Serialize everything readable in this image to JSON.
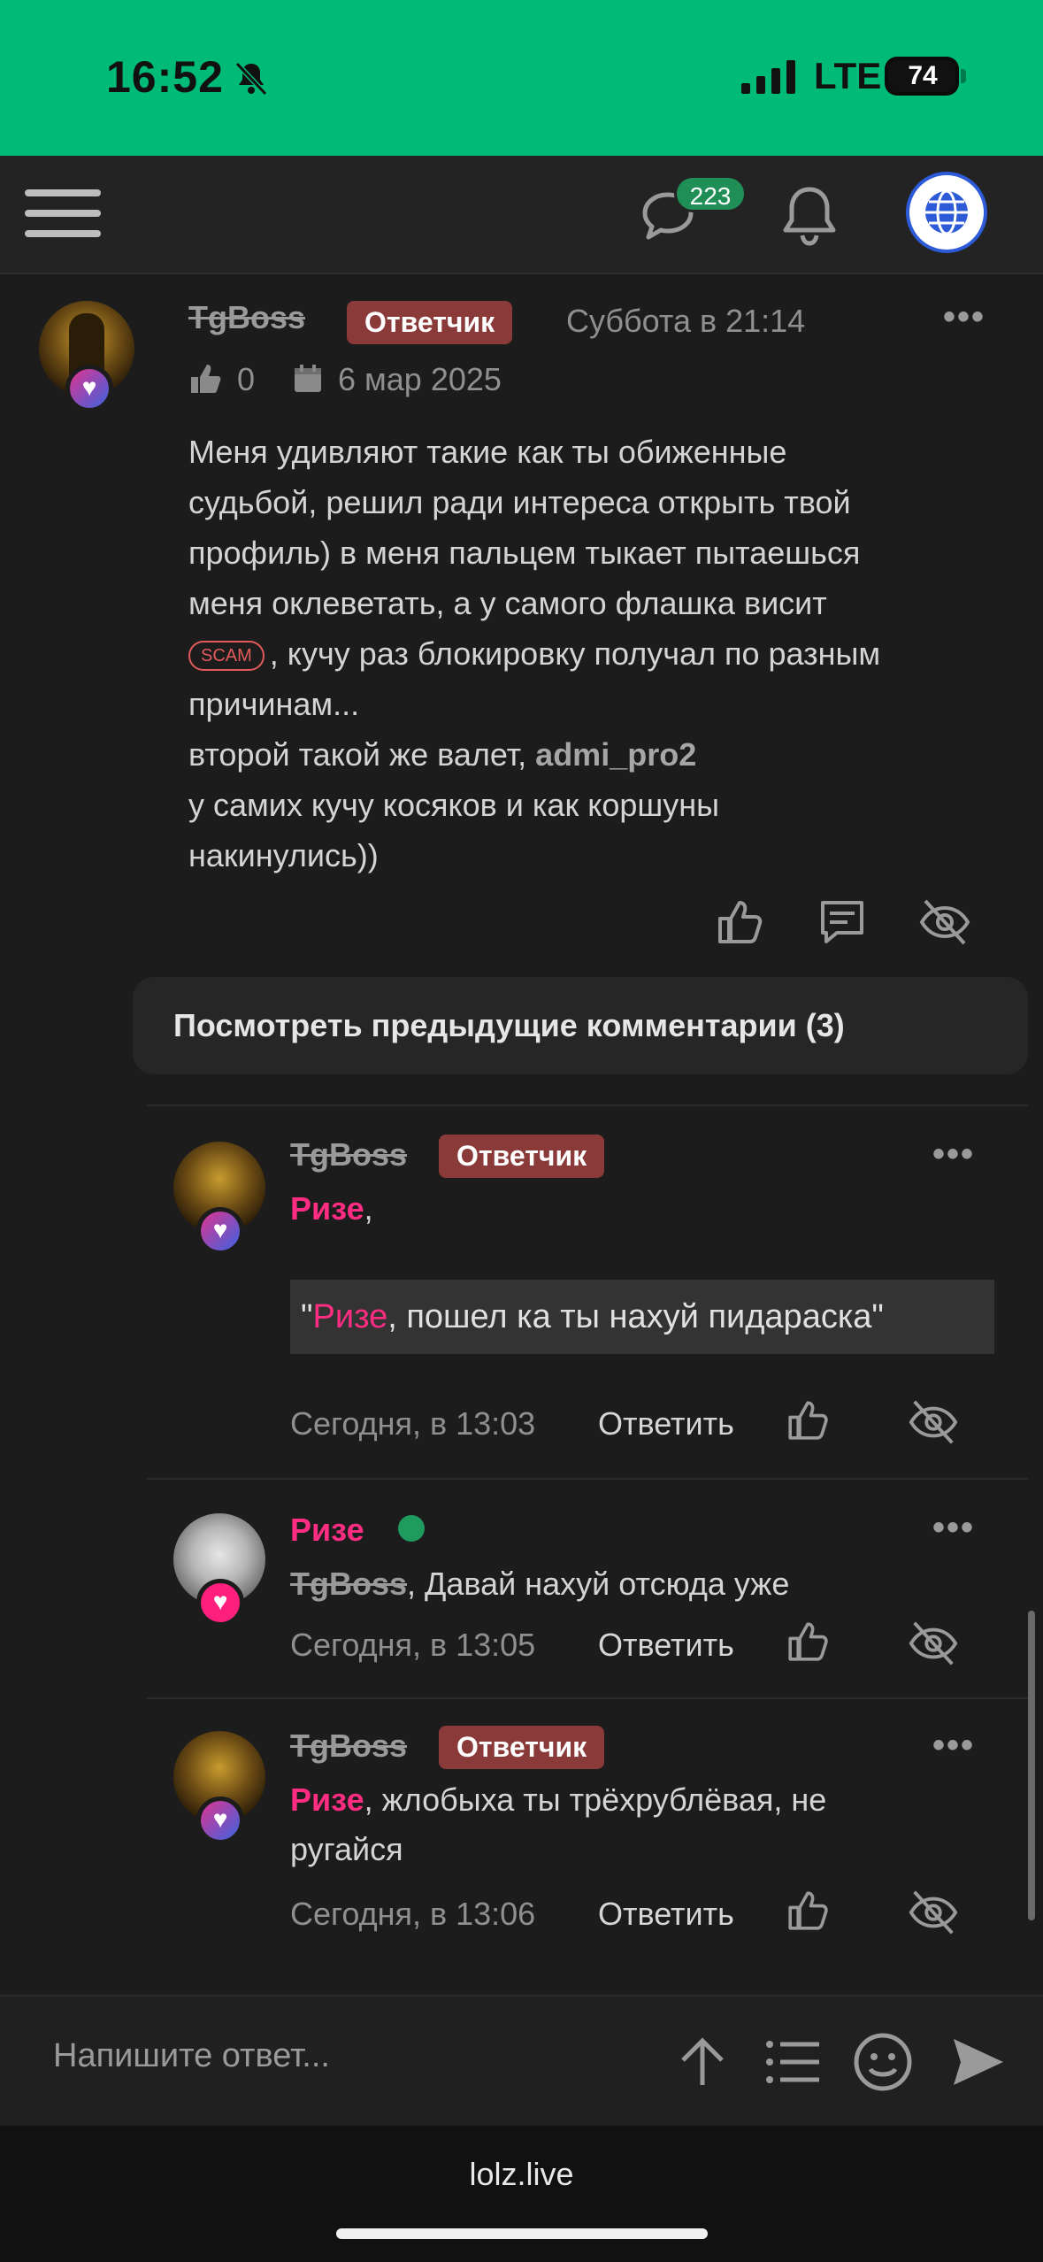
{
  "status_bar": {
    "time": "16:52",
    "network": "LTE",
    "battery": "74"
  },
  "header": {
    "messages_badge": "223"
  },
  "post": {
    "author": "TgBoss",
    "role": "Ответчик",
    "timestamp": "Суббота в 21:14",
    "likes": "0",
    "date": "6 мар 2025",
    "body": {
      "line1": "Меня удивляют такие как ты обиженные",
      "line2": "судьбой, решил ради интереса открыть твой",
      "line3": "профиль) в меня пальцем тыкает пытаешься",
      "line4": "меня оклеветать, а у самого флашка висит",
      "scam_badge": "SCAM",
      "line5": ", кучу раз блокировку получал по разным",
      "line6": "причинам...",
      "line7_prefix": "второй такой же валет, ",
      "line7_mention": "admi_pro2",
      "line8": "у самих кучу косяков и как коршуны",
      "line9": "накинулись))"
    }
  },
  "prev_comments_label": "Посмотреть предыдущие комментарии (3)",
  "comments": [
    {
      "author": "TgBoss",
      "role": "Ответчик",
      "mention": "Ризе",
      "text": ",",
      "quote_open": "\"",
      "quote_mention": "Ризе",
      "quote_text": ", пошел ка ты нахуй пидараска\"",
      "time": "Сегодня, в 13:03",
      "reply_label": "Ответить"
    },
    {
      "author": "Ризе",
      "mention": "TgBoss",
      "text": ", Давай нахуй отсюда уже",
      "time": "Сегодня, в 13:05",
      "reply_label": "Ответить"
    },
    {
      "author": "TgBoss",
      "role": "Ответчик",
      "mention": "Ризе",
      "text_line1": ", жлобыха ты трёхрублёвая, не",
      "text_line2": "ругайся",
      "time": "Сегодня, в 13:06",
      "reply_label": "Ответить"
    }
  ],
  "composer": {
    "placeholder": "Напишите ответ..."
  },
  "browser": {
    "url": "lolz.live"
  },
  "colors": {
    "status_bar": "#00ba78",
    "role_badge": "#8b3a3a",
    "mention_pink": "#ff2d82",
    "online": "#1f9b5e"
  }
}
